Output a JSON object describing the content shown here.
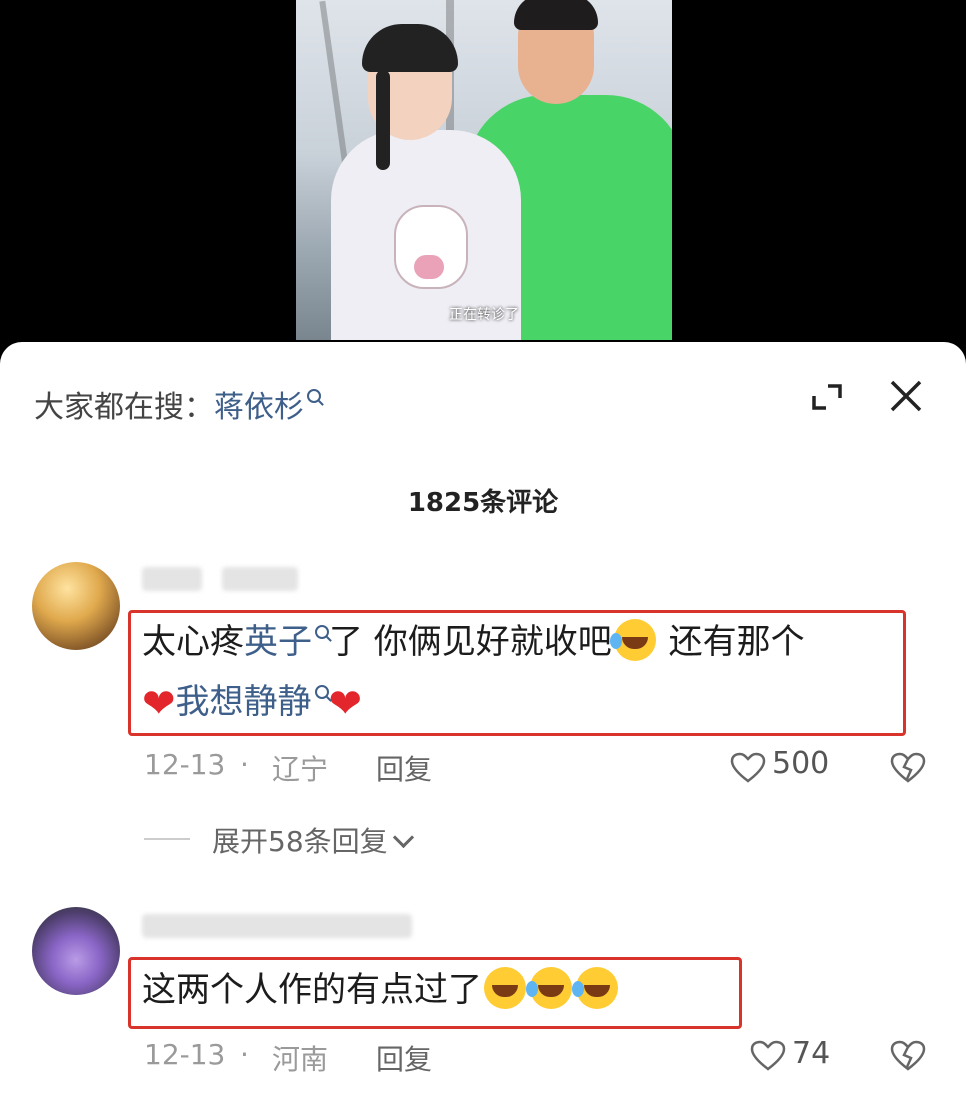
{
  "video": {
    "subtitle": "正在转诊了"
  },
  "search": {
    "prefix": "大家都在搜：",
    "term": "蒋依杉",
    "icon": "search-icon"
  },
  "header": {
    "expand_icon": "expand-icon",
    "close_icon": "close-icon"
  },
  "comments_count": "1825条评论",
  "comments": [
    {
      "text_part1": "太心疼",
      "link1": "英子",
      "text_part2": "了 你俩见好就收吧",
      "text_part3": " 还有那个",
      "link2": "我想静静",
      "date": "12-13",
      "location": "辽宁",
      "reply_label": "回复",
      "likes": "500",
      "expand_replies": "展开58条回复"
    },
    {
      "text": "这两个人作的有点过了",
      "date": "12-13",
      "location": "河南",
      "reply_label": "回复",
      "likes": "74"
    }
  ],
  "colors": {
    "link": "#3e5f8a",
    "highlight_border": "#d9342b",
    "sheet_bg": "#ffffff"
  }
}
